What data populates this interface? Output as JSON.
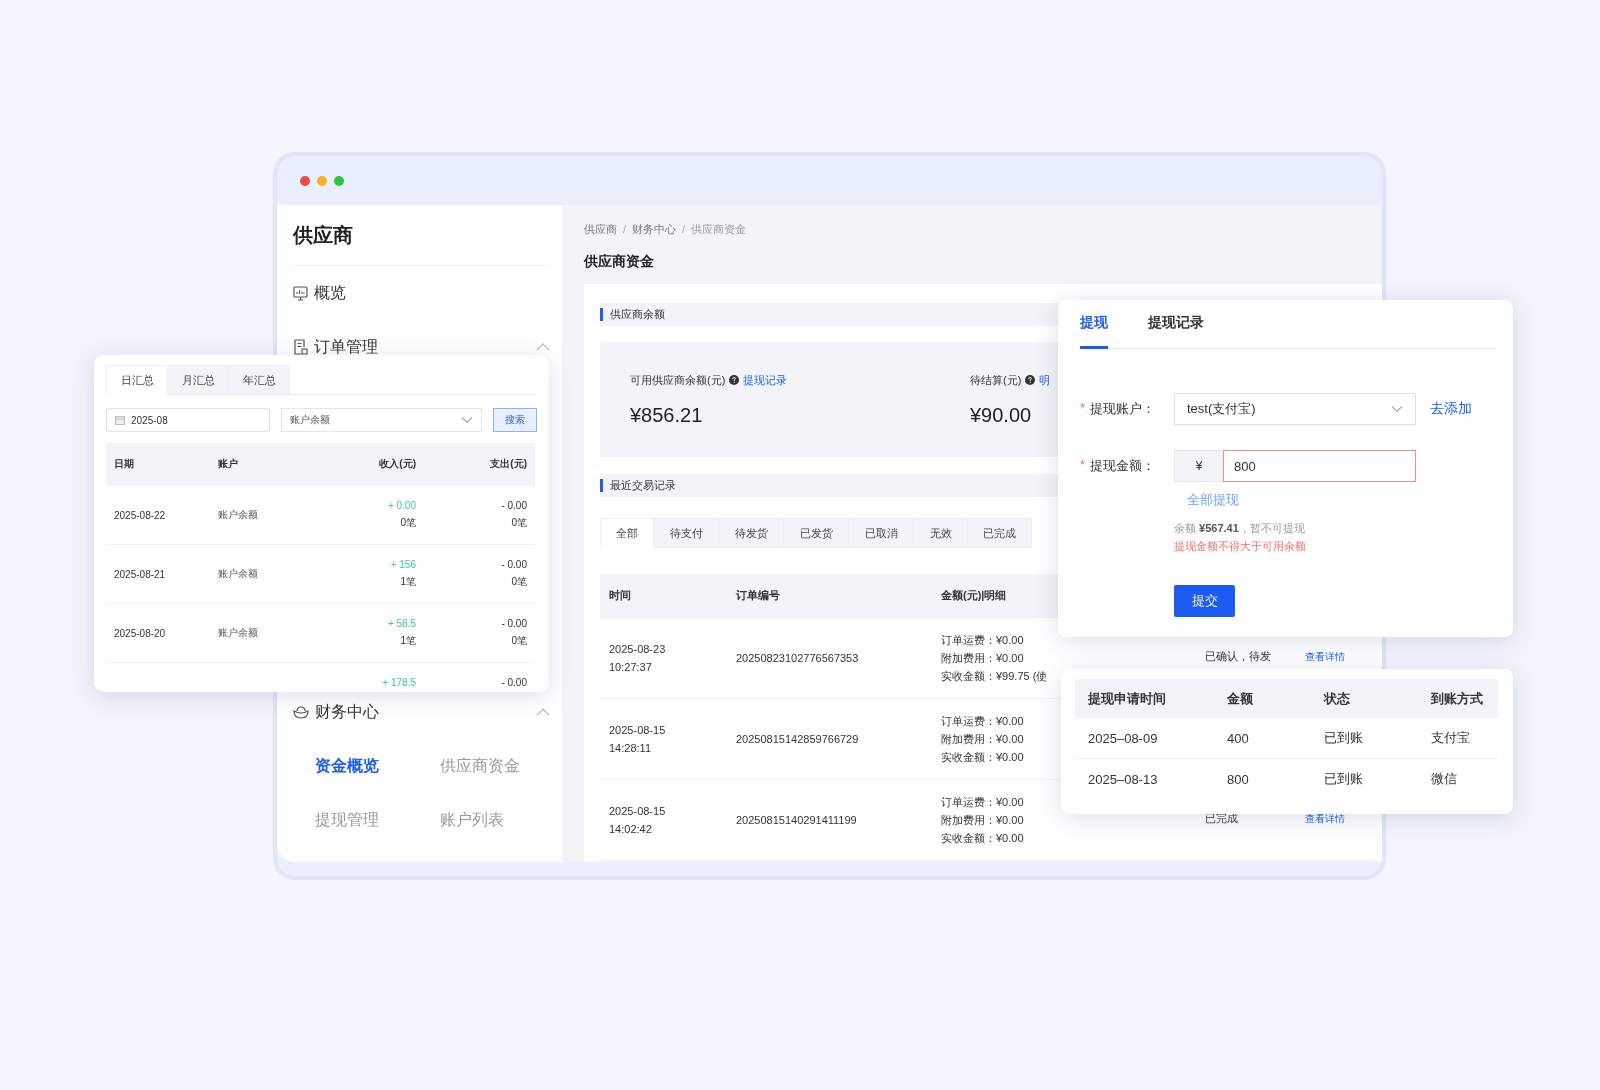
{
  "sidebar": {
    "title": "供应商",
    "items": [
      {
        "kind": "link",
        "label": "概览"
      },
      {
        "kind": "group",
        "label": "订单管理",
        "expanded": true
      },
      {
        "kind": "group",
        "label": "财务中心",
        "expanded": true,
        "children": [
          {
            "label": "资金概览",
            "selected": true
          },
          {
            "label": "供应商资金",
            "selected": false
          },
          {
            "label": "提现管理",
            "selected": false
          },
          {
            "label": "账户列表",
            "selected": false
          }
        ]
      }
    ]
  },
  "breadcrumb": [
    "供应商",
    "财务中心",
    "供应商资金"
  ],
  "breadcrumb_separator": "/",
  "page_title": "供应商资金",
  "balance_section": {
    "title": "供应商余额",
    "cards": [
      {
        "label": "可用供应商余额(元)",
        "link": "提现记录",
        "value": "¥856.21"
      },
      {
        "label": "待结算(元)",
        "link": "明",
        "value": "¥90.00"
      }
    ]
  },
  "transactions": {
    "title": "最近交易记录",
    "tabs": [
      {
        "label": "全部",
        "selected": true
      },
      {
        "label": "待支付",
        "selected": false
      },
      {
        "label": "待发货",
        "selected": false
      },
      {
        "label": "已发货",
        "selected": false
      },
      {
        "label": "已取消",
        "selected": false
      },
      {
        "label": "无效",
        "selected": false
      },
      {
        "label": "已完成",
        "selected": false
      }
    ],
    "columns": [
      "时间",
      "订单编号",
      "金额(元)|明细"
    ],
    "rows": [
      {
        "date": "2025-08-23",
        "time": "10:27:37",
        "order_no": "20250823102776567353",
        "details": [
          "订单运费：¥0.00",
          "附加费用：¥0.00",
          "实收金额：¥99.75 (使"
        ],
        "status": "已确认，待发",
        "action": "查看详情"
      },
      {
        "date": "2025-08-15",
        "time": "14:28:11",
        "order_no": "20250815142859766729",
        "details": [
          "订单运费：¥0.00",
          "附加费用：¥0.00",
          "实收金额：¥0.00"
        ]
      },
      {
        "date": "2025-08-15",
        "time": "14:02:42",
        "order_no": "20250815140291411199",
        "details": [
          "订单运费：¥0.00",
          "附加费用：¥0.00",
          "实收金额：¥0.00"
        ],
        "status": "已完成",
        "action": "查看详情"
      }
    ]
  },
  "summary_panel": {
    "tabs": [
      {
        "label": "日汇总",
        "selected": true
      },
      {
        "label": "月汇总",
        "selected": false
      },
      {
        "label": "年汇总",
        "selected": false
      }
    ],
    "date_field": "2025-08",
    "account_select": "账户余额",
    "search_button": "搜索",
    "columns": [
      "日期",
      "账户",
      "收入(元)",
      "支出(元)"
    ],
    "rows": [
      {
        "date": "2025-08-22",
        "account": "账户余额",
        "income": "+ 0.00",
        "income_count": "0笔",
        "expense": "- 0.00",
        "expense_count": "0笔"
      },
      {
        "date": "2025-08-21",
        "account": "账户余额",
        "income": "+ 156",
        "income_count": "1笔",
        "expense": "- 0.00",
        "expense_count": "0笔"
      },
      {
        "date": "2025-08-20",
        "account": "账户余额",
        "income": "+ 58.5",
        "income_count": "1笔",
        "expense": "- 0.00",
        "expense_count": "0笔"
      },
      {
        "income": "+ 178.5",
        "expense": "- 0.00"
      }
    ]
  },
  "withdraw_panel": {
    "tabs": [
      {
        "label": "提现",
        "selected": true
      },
      {
        "label": "提现记录",
        "selected": false
      }
    ],
    "account": {
      "label": "提现账户：",
      "required_mark": "*",
      "value": "test(支付宝)",
      "link": "去添加"
    },
    "amount": {
      "label": "提现金额：",
      "required_mark": "*",
      "prefix": "¥",
      "value": "800",
      "invalid": true,
      "link": "全部提现"
    },
    "balance_note": "余额 **¥567.41**，暂不可提现",
    "error": "提现金额不得大于可用余额",
    "submit": "提交"
  },
  "records_panel": {
    "columns": [
      "提现申请时间",
      "金额",
      "状态",
      "到账方式"
    ],
    "rows": [
      [
        "2025–08-09",
        "400",
        "已到账",
        "支付宝"
      ],
      [
        "2025–08-13",
        "800",
        "已到账",
        "微信"
      ]
    ]
  }
}
